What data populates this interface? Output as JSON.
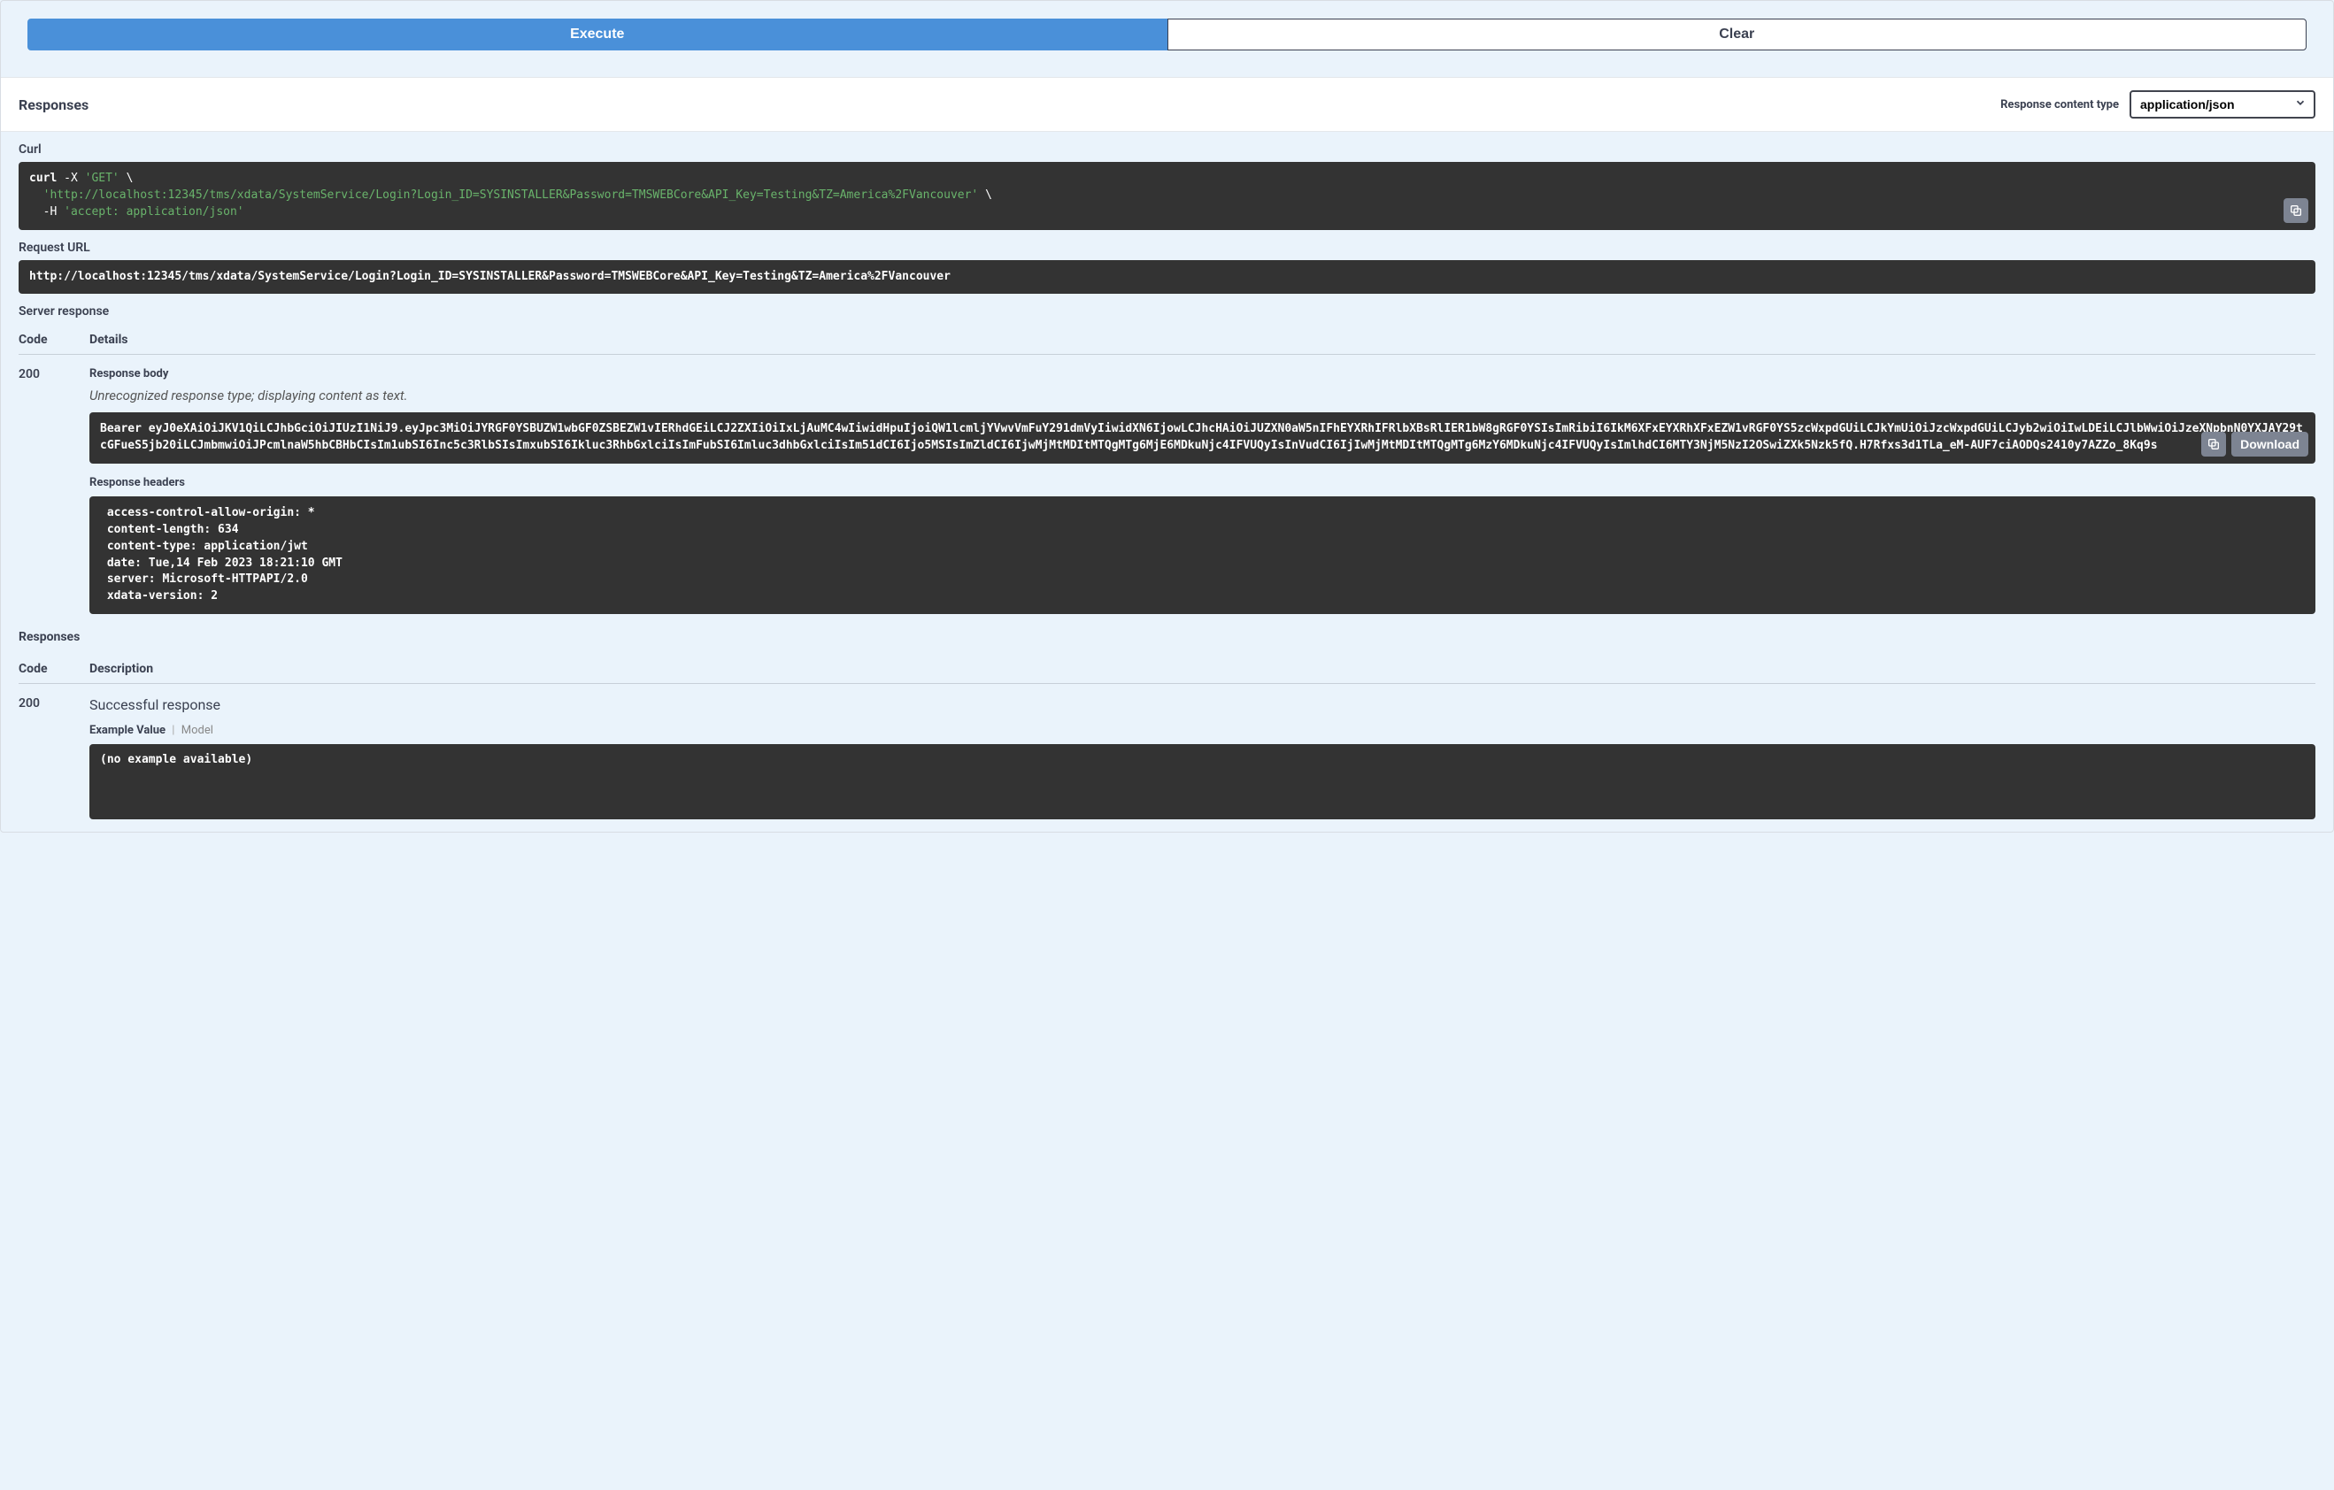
{
  "buttons": {
    "execute": "Execute",
    "clear": "Clear"
  },
  "responses_header": {
    "title": "Responses",
    "content_type_label": "Response content type",
    "content_type_value": "application/json"
  },
  "curl": {
    "label": "Curl",
    "cmd": "curl",
    "flag_x": "-X",
    "method": "'GET'",
    "backslash": " \\",
    "url": "'http://localhost:12345/tms/xdata/SystemService/Login?Login_ID=SYSINSTALLER&Password=TMSWEBCore&API_Key=Testing&TZ=America%2FVancouver'",
    "flag_h": "-H",
    "accept": "'accept: application/json'"
  },
  "request_url": {
    "label": "Request URL",
    "value": "http://localhost:12345/tms/xdata/SystemService/Login?Login_ID=SYSINSTALLER&Password=TMSWEBCore&API_Key=Testing&TZ=America%2FVancouver"
  },
  "server_response": {
    "label": "Server response",
    "code_header": "Code",
    "details_header": "Details",
    "code_value": "200",
    "body_label": "Response body",
    "unrecognized_note": "Unrecognized response type; displaying content as text.",
    "body_content": "Bearer eyJ0eXAiOiJKV1QiLCJhbGciOiJIUzI1NiJ9.eyJpc3MiOiJYRGF0YSBUZW1wbGF0ZSBEZW1vIERhdGEiLCJ2ZXIiOiIxLjAuMC4wIiwidHpuIjoiQW1lcmljYVwvVmFuY291dmVyIiwidXN6IjowLCJhcHAiOiJUZXN0aW5nIFhEYXRhIFRlbXBsRlIER1bW8gRGF0YSIsImRibiI6IkM6XFxEYXRhXFxEZW1vRGF0YS5zcWxpdGUiLCJkYmUiOiJzcWxpdGUiLCJyb2wiOiIwLDEiLCJlbWwiOiJzeXNpbnN0YXJAY29tcGFueS5jb20iLCJmbmwiOiJPcmlnaW5hbCBHbCIsIm1ubSI6Inc5c3RlbSIsImxubSI6Ikluc3RhbGxlciIsImFubSI6Imluc3dhbGxlciIsIm51dCI6Ijo5MSIsImZldCI6IjwMjMtMDItMTQgMTg6MjE6MDkuNjc4IFVUQyIsInVudCI6IjIwMjMtMDItMTQgMTg6MzY6MDkuNjc4IFVUQyIsImlhdCI6MTY3NjM5NzI2OSwiZXk5Nzk5fQ.H7Rfxs3d1TLa_eM-AUF7ciAODQs2410y7AZZo_8Kq9s",
    "download_label": "Download",
    "headers_label": "Response headers",
    "headers_content": " access-control-allow-origin: * \n content-length: 634 \n content-type: application/jwt \n date: Tue,14 Feb 2023 18:21:10 GMT \n server: Microsoft-HTTPAPI/2.0 \n xdata-version: 2 "
  },
  "documented": {
    "title": "Responses",
    "code_header": "Code",
    "desc_header": "Description",
    "code_value": "200",
    "description": "Successful response",
    "example_tab": "Example Value",
    "model_tab": "Model",
    "example_content": "(no example available)"
  }
}
